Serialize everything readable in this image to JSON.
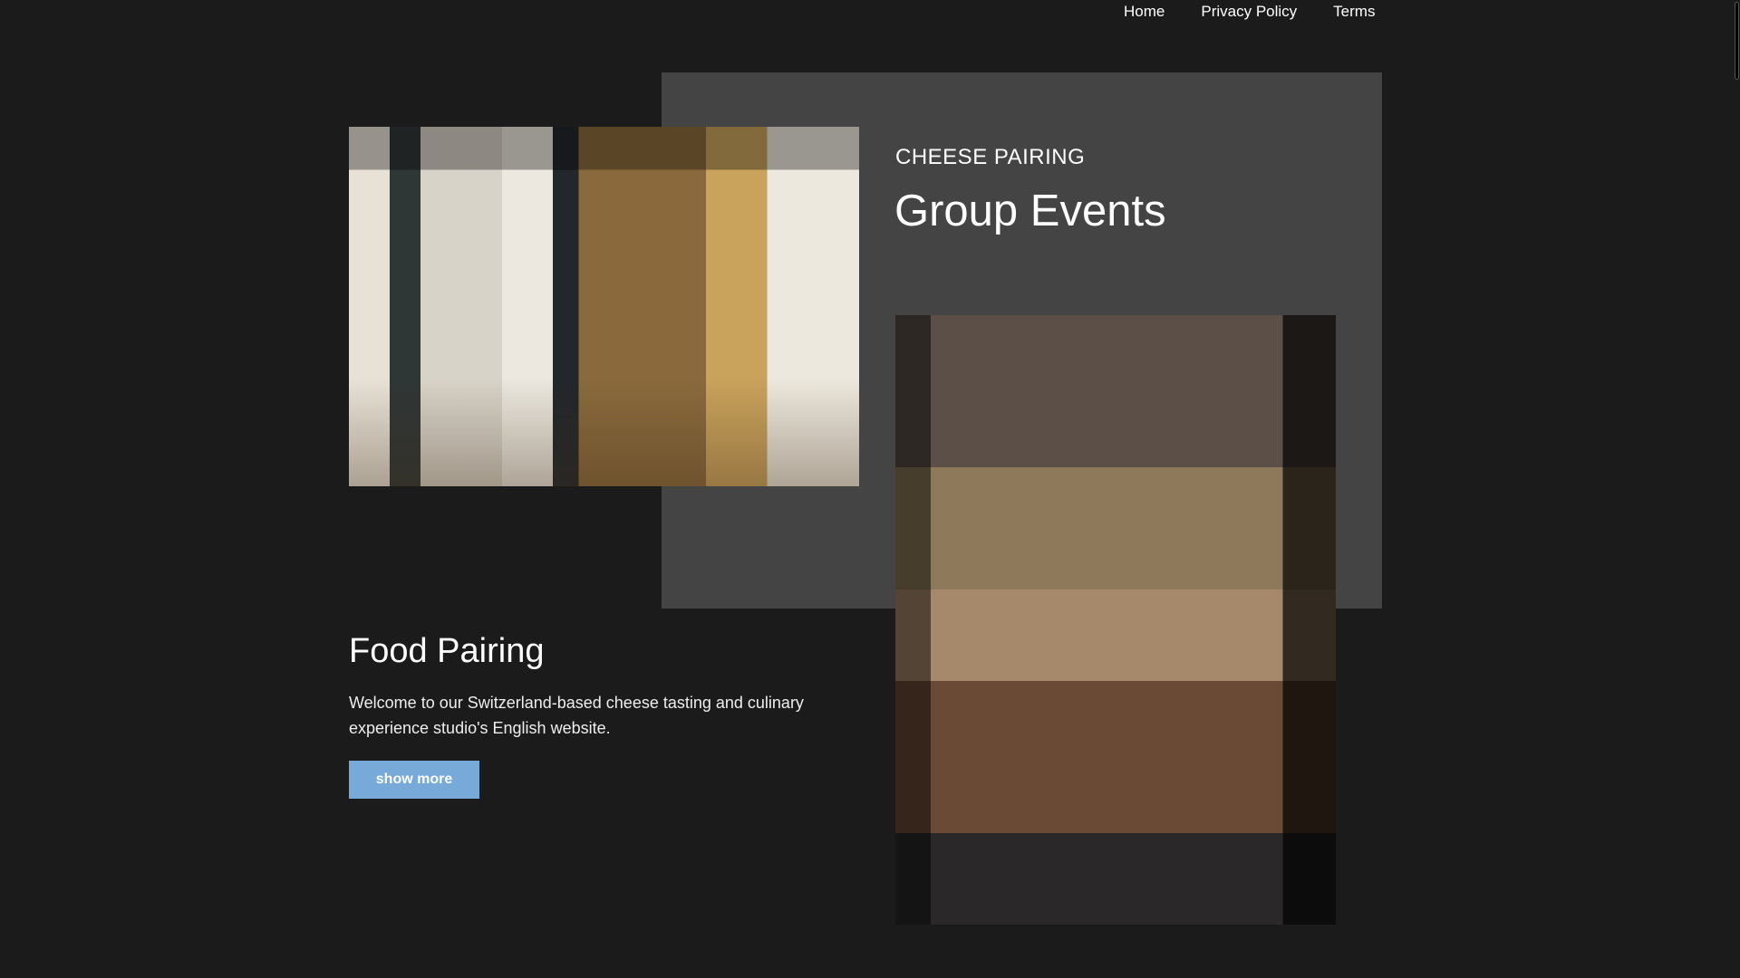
{
  "nav": {
    "items": [
      "Home",
      "Privacy Policy",
      "Terms"
    ]
  },
  "events": {
    "kicker": "CHEESE PAIRING",
    "title": "Group Events"
  },
  "food": {
    "title": "Food Pairing",
    "text": "Welcome to our Switzerland-based cheese tasting and culinary experience studio's English website.",
    "button": "show more"
  },
  "colors": {
    "background": "#1b1b1b",
    "panel": "#444444",
    "button": "#77aad9"
  }
}
